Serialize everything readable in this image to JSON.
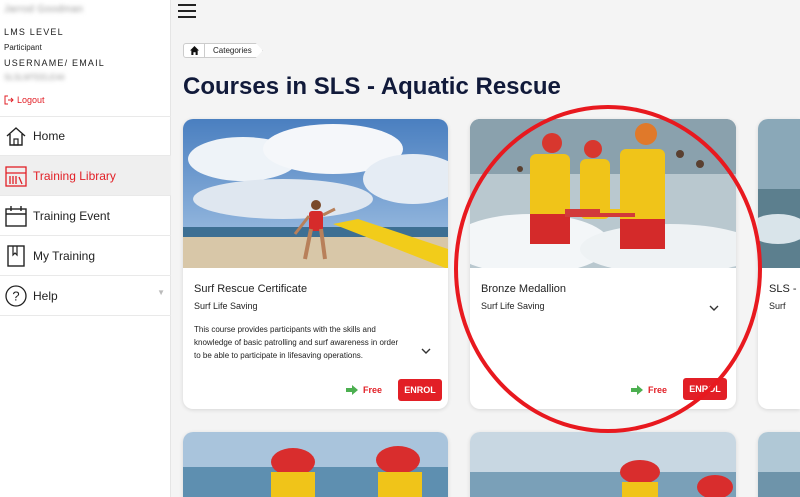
{
  "sidebar": {
    "user_name": "Jarrod Goodman",
    "lms_level_label": "LMS LEVEL",
    "lms_level_value": "Participant",
    "username_label": "USERNAME/ EMAIL",
    "username_value": "SLSLMTEELE44",
    "logout_label": "Logout",
    "nav": [
      {
        "label": "Home",
        "icon": "home-icon"
      },
      {
        "label": "Training Library",
        "icon": "library-icon"
      },
      {
        "label": "Training Event",
        "icon": "calendar-icon"
      },
      {
        "label": "My Training",
        "icon": "book-icon"
      },
      {
        "label": "Help",
        "icon": "help-icon"
      }
    ]
  },
  "breadcrumb": {
    "home_icon": "home-icon",
    "categories": "Categories"
  },
  "page_title": "Courses in SLS - Aquatic Rescue",
  "courses": [
    {
      "title": "Surf Rescue Certificate",
      "org": "Surf Life Saving",
      "description": "This course provides participants with the skills and knowledge of basic patrolling and surf awareness in order to be able to participate in lifesaving operations.",
      "price": "Free",
      "action": "ENROL"
    },
    {
      "title": "Bronze Medallion",
      "org": "Surf Life Saving",
      "price": "Free",
      "action": "ENROL"
    },
    {
      "title": "SLS -",
      "org": "Surf"
    }
  ],
  "colors": {
    "accent": "#e21f26",
    "title": "#111a3a",
    "free_arrow": "#4caf50"
  }
}
